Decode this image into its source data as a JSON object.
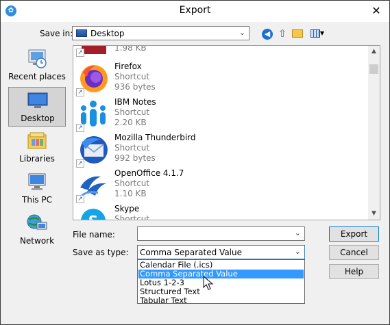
{
  "window": {
    "title": "Export",
    "close_glyph": "✕",
    "app_icon": "app-logo-icon"
  },
  "toolbar": {
    "save_in_label": "Save in:",
    "save_in_value": "Desktop",
    "icons": [
      "back-icon",
      "up-folder-icon",
      "new-folder-icon",
      "view-menu-icon"
    ]
  },
  "places": [
    {
      "label": "Recent places",
      "icon": "recent-places-icon"
    },
    {
      "label": "Desktop",
      "icon": "desktop-icon",
      "selected": true
    },
    {
      "label": "Libraries",
      "icon": "libraries-icon"
    },
    {
      "label": "This PC",
      "icon": "this-pc-icon"
    },
    {
      "label": "Network",
      "icon": "network-icon"
    }
  ],
  "files": [
    {
      "name": "",
      "type": "",
      "size": "1.98 KB",
      "icon": "partial-app-icon"
    },
    {
      "name": "Firefox",
      "type": "Shortcut",
      "size": "936 bytes",
      "icon": "firefox-icon"
    },
    {
      "name": "IBM Notes",
      "type": "Shortcut",
      "size": "2.20 KB",
      "icon": "ibm-notes-icon"
    },
    {
      "name": "Mozilla Thunderbird",
      "type": "Shortcut",
      "size": "992 bytes",
      "icon": "thunderbird-icon"
    },
    {
      "name": "OpenOffice 4.1.7",
      "type": "Shortcut",
      "size": "1.10 KB",
      "icon": "openoffice-icon"
    },
    {
      "name": "Skype",
      "type": "Shortcut",
      "size": "",
      "icon": "skype-icon"
    }
  ],
  "form": {
    "file_name_label": "File name:",
    "file_name_value": "",
    "save_as_type_label": "Save as type:",
    "save_as_type_value": "Comma Separated Value",
    "type_options": [
      "Calendar File (.ics)",
      "Comma Separated Value",
      "Lotus 1-2-3",
      "Structured Text",
      "Tabular Text"
    ],
    "selected_option_index": 1
  },
  "buttons": {
    "export": "Export",
    "cancel": "Cancel",
    "help": "Help"
  },
  "colors": {
    "selection": "#3399ff",
    "default_button_border": "#0078d7"
  }
}
